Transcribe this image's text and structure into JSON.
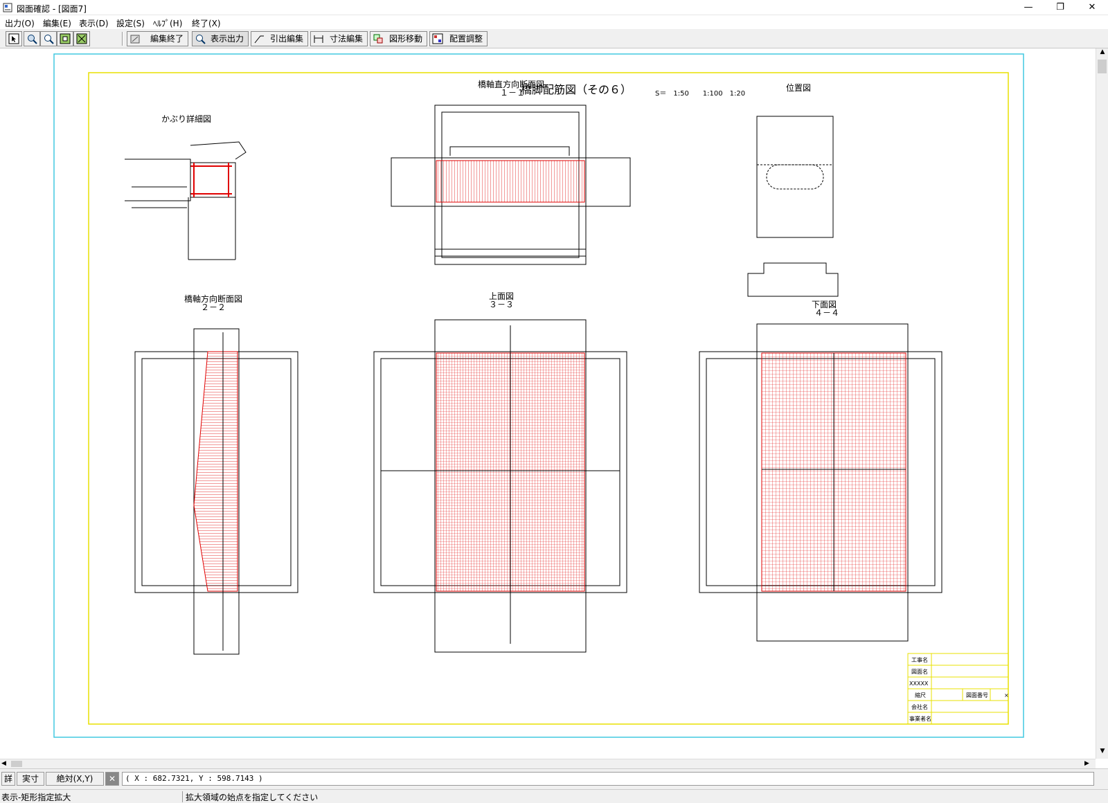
{
  "window": {
    "title": "図面確認 - [図面7]",
    "minimize": "—",
    "restore": "❐",
    "close": "✕"
  },
  "menu": [
    "出力(O)",
    "編集(E)",
    "表示(D)",
    "設定(S)",
    "ﾍﾙﾌﾟ(H)",
    "終了(X)"
  ],
  "toolbar": {
    "edit_end": "編集終了",
    "display_output": "表示出力",
    "leader_edit": "引出編集",
    "dimension_edit": "寸法編集",
    "shape_move": "図形移動",
    "layout_adjust": "配置調整"
  },
  "drawing": {
    "title": "橋脚配筋図（その６）",
    "scale": "S＝　1:50　　1:100　1:20",
    "views": {
      "cover_detail": "かぶり詳細図",
      "section11_title": "橋軸直方向断面図",
      "section11_label": "１－１",
      "location": "位置図",
      "section22_title": "橋軸方向断面図",
      "section22_label": "２－２",
      "top_title": "上面図",
      "top_label": "３－３",
      "bottom_title": "下面図",
      "bottom_label": "４－４"
    },
    "title_block": {
      "project": "工事名",
      "drawing_name": "図面名",
      "xxxxx": "XXXXX",
      "scale_label": "縮尺",
      "drawing_no": "図面番号",
      "mark": "×",
      "company": "会社名",
      "office": "事業者名"
    }
  },
  "status": {
    "detail": "詳",
    "actual": "実寸",
    "absolute": "絶対(X,Y)",
    "coords": "( X : 682.7321, Y : 598.7143 )"
  },
  "messages": {
    "mode": "表示-矩形指定拡大",
    "prompt": "拡大領域の始点を指定してください"
  }
}
